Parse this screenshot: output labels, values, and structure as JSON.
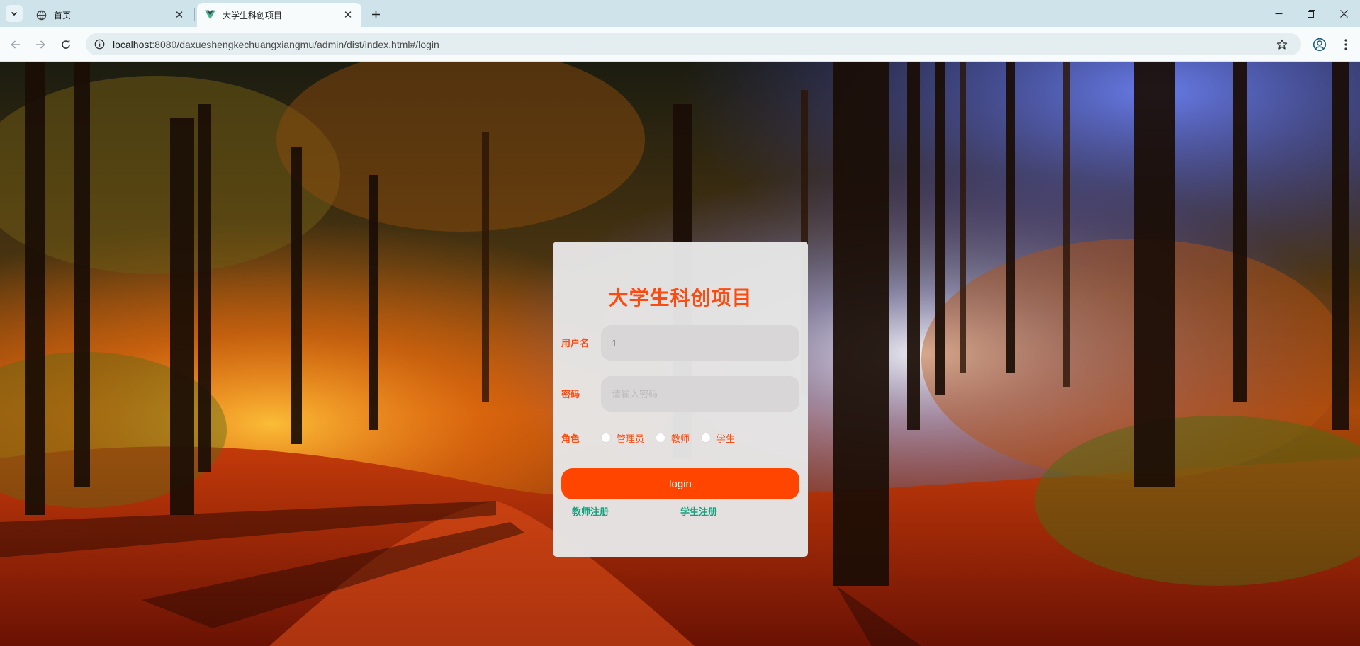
{
  "browser": {
    "tabs": [
      {
        "title": "首页",
        "icon": "globe-icon"
      },
      {
        "title": "大学生科创项目",
        "icon": "vue-logo-icon",
        "active": true
      }
    ],
    "url_host": "localhost",
    "url_rest": ":8080/daxueshengkechuangxiangmu/admin/dist/index.html#/login"
  },
  "login": {
    "title": "大学生科创项目",
    "username_label": "用户名",
    "username_value": "1",
    "password_label": "密码",
    "password_placeholder": "请输入密码",
    "role_label": "角色",
    "roles": [
      "管理员",
      "教师",
      "学生"
    ],
    "login_button": "login",
    "register_teacher": "教师注册",
    "register_student": "学生注册"
  },
  "colors": {
    "accent": "#ff4500",
    "title": "#ff4a0f",
    "link": "#14a37f",
    "card": "#e6e6e6"
  }
}
